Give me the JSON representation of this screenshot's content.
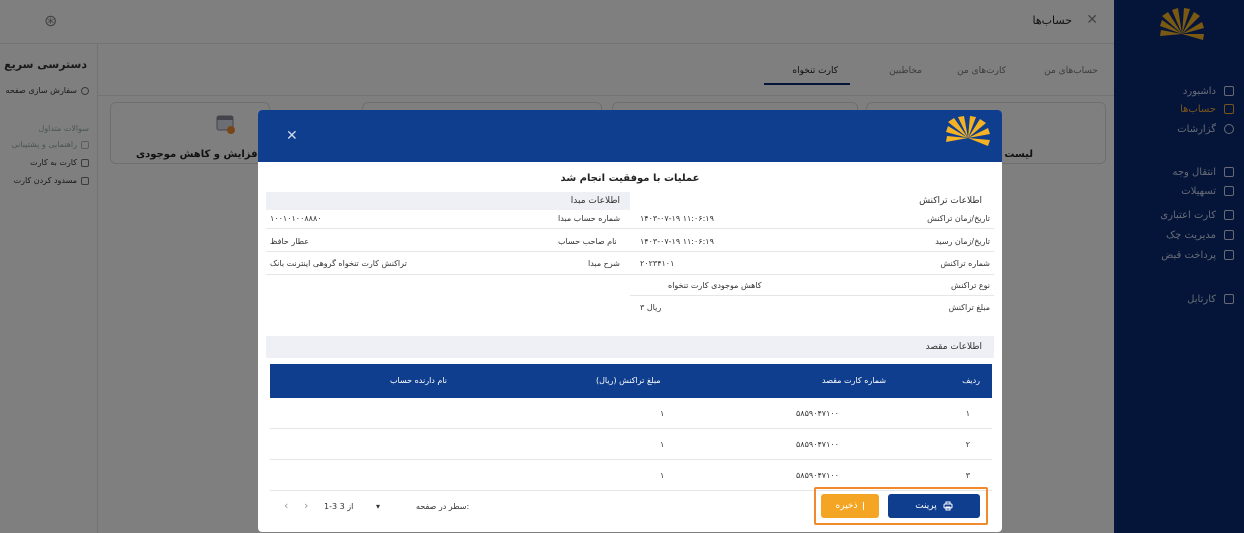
{
  "topbar": {
    "title": "حساب‌ها",
    "close_symbol": "✕",
    "user_symbol": "⊛"
  },
  "sidebar": {
    "items": [
      {
        "label": "داشبورد"
      },
      {
        "label": "حساب‌ها"
      },
      {
        "label": "گزارشات"
      },
      {
        "label": "انتقال وجه"
      },
      {
        "label": "تسهیلات"
      },
      {
        "label": "کارت اعتباری"
      },
      {
        "label": "مدیریت چک"
      },
      {
        "label": "پرداخت قبض"
      },
      {
        "label": "کارتابل"
      }
    ],
    "active_index": 1
  },
  "quick_access": {
    "title": "دسترسی سریع",
    "customize": "سفارش سازی صفحه",
    "faq": "سوالات متداول",
    "help": "راهنمایی و پشتیبانی",
    "card_to_card": "کارت به کارت",
    "block_card": "مسدود کردن کارت"
  },
  "tabs": [
    {
      "label": "حساب‌های من"
    },
    {
      "label": "کارت‌های من"
    },
    {
      "label": "مخاطبین"
    },
    {
      "label": "کارت تنخواه"
    }
  ],
  "cards": {
    "left_label": "افزایش و کاهش موجودی",
    "right_label": "لیست"
  },
  "modal": {
    "close_symbol": "✕",
    "success_message": "عملیات با موفقیت انجام شد",
    "transaction_info": {
      "title": "اطلاعات تراکنش",
      "rows": [
        {
          "label": "تاریخ/زمان تراکنش",
          "value": "۱۴۰۳-۰۷-۱۹ ۱۱:۰۶:۱۹"
        },
        {
          "label": "تاریخ/زمان رسید",
          "value": "۱۴۰۳-۰۷-۱۹ ۱۱:۰۶:۱۹"
        },
        {
          "label": "شماره تراکنش",
          "value": "۲۰۲۳۴۱۰۱"
        },
        {
          "label": "نوع تراکنش",
          "value": "کاهش موجودی کارت تنخواه"
        },
        {
          "label": "مبلغ تراکنش",
          "value": "۳ ریال"
        }
      ]
    },
    "source_info": {
      "title": "اطلاعات مبدا",
      "rows": [
        {
          "label": "شماره حساب مبدا",
          "value": "۱۰۰۱۰۱۰۰۸۸۸۰"
        },
        {
          "label": "نام صاحب حساب",
          "value": "عطار حافظ"
        },
        {
          "label": "شرح مبدا",
          "value": "تراکنش کارت تنخواه گروهی اینترنت بانک"
        }
      ]
    },
    "destination_title": "اطلاعات مقصد",
    "table": {
      "headers": [
        "ردیف",
        "شماره کارت مقصد",
        "مبلغ تراکنش (ریال)",
        "نام دارنده حساب"
      ],
      "rows": [
        [
          "۱",
          "۵۸۵۹۰۴۷۱۰۰",
          "۱",
          ""
        ],
        [
          "۲",
          "۵۸۵۹۰۴۷۱۰۰",
          "۱",
          ""
        ],
        [
          "۳",
          "۵۸۵۹۰۴۷۱۰۰",
          "۱",
          ""
        ]
      ]
    },
    "pagination": {
      "rows_per_page_label": "سطر در صفحه:",
      "range": "1-3 از 3",
      "prev": "‹",
      "next": "›",
      "dropdown": "▾"
    },
    "buttons": {
      "print": "پرینت",
      "save": "ذخیره"
    }
  },
  "colors": {
    "brand_navy": "#0f3e8e",
    "sidebar": "#0a2a73",
    "accent_orange": "#f5a524",
    "highlight": "#f08a2c"
  }
}
